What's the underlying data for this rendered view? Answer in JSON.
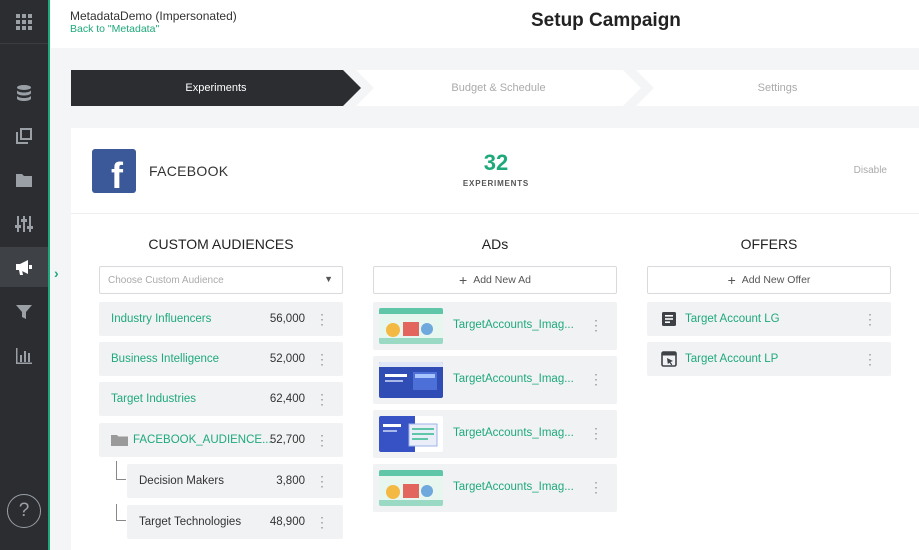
{
  "header": {
    "account_name": "MetadataDemo (Impersonated)",
    "back_link": "Back to \"Metadata\"",
    "page_title": "Setup Campaign"
  },
  "sidebar": {
    "icons": [
      "apps-grid-icon",
      "database-icon",
      "copy-icon",
      "folder-icon",
      "sliders-icon",
      "megaphone-icon",
      "filter-icon",
      "bar-chart-icon"
    ],
    "active": "megaphone-icon",
    "help": "?",
    "expand": "›"
  },
  "stepper": {
    "steps": [
      {
        "label": "Experiments",
        "active": true
      },
      {
        "label": "Budget & Schedule",
        "active": false
      },
      {
        "label": "Settings",
        "active": false
      }
    ]
  },
  "platform": {
    "name": "FACEBOOK",
    "logo_letter": "f",
    "experiments_count": "32",
    "experiments_label": "EXPERIMENTS",
    "disable_label": "Disable"
  },
  "colors": {
    "accent": "#1fa97b",
    "sidebar_bg": "#2b2d31",
    "facebook_blue": "#3b5998"
  },
  "audiences": {
    "title": "CUSTOM AUDIENCES",
    "dropdown_placeholder": "Choose Custom Audience",
    "items": [
      {
        "label": "Industry Influencers",
        "count": "56,000"
      },
      {
        "label": "Business Intelligence",
        "count": "52,000"
      },
      {
        "label": "Target Industries",
        "count": "62,400"
      },
      {
        "label": "FACEBOOK_AUDIENCE...",
        "count": "52,700"
      },
      {
        "label": "Decision Makers",
        "count": "3,800"
      },
      {
        "label": "Target Technologies",
        "count": "48,900"
      }
    ]
  },
  "ads": {
    "title": "ADs",
    "add_label": "Add New Ad",
    "items": [
      {
        "label": "TargetAccounts_Imag..."
      },
      {
        "label": "TargetAccounts_Imag..."
      },
      {
        "label": "TargetAccounts_Imag..."
      },
      {
        "label": "TargetAccounts_Imag..."
      }
    ]
  },
  "offers": {
    "title": "OFFERS",
    "add_label": "Add New Offer",
    "items": [
      {
        "label": "Target Account LG",
        "icon": "form-icon"
      },
      {
        "label": "Target Account LP",
        "icon": "landing-page-icon"
      }
    ]
  },
  "common": {
    "plus": "+",
    "more": "⋮",
    "caret": "⌄"
  }
}
